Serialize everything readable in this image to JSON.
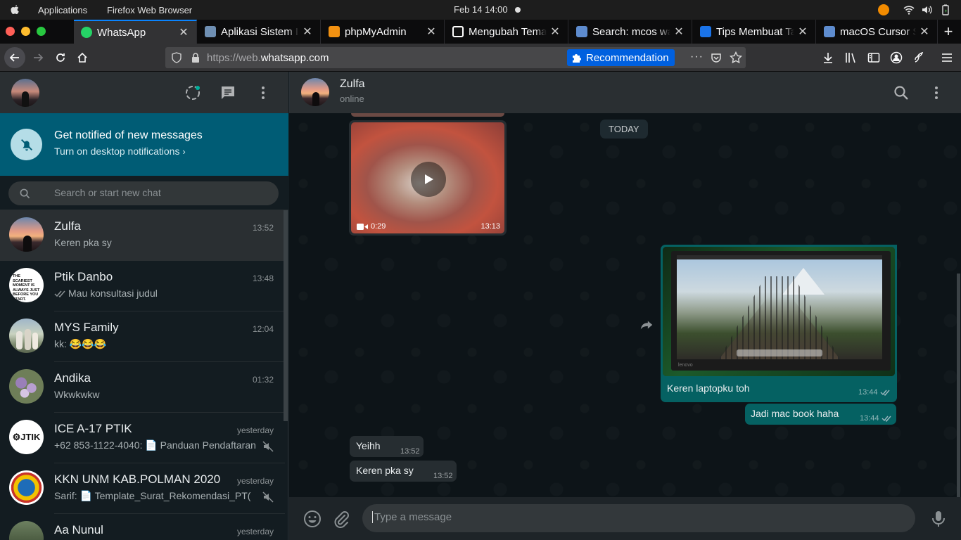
{
  "os": {
    "menu": [
      "Applications",
      "Firefox Web Browser"
    ],
    "clock": "Feb 14  14:00"
  },
  "browser": {
    "tabs": [
      {
        "title": "WhatsApp",
        "active": true,
        "favicon_color": "#25d366"
      },
      {
        "title": "Aplikasi Sistem Informasi",
        "active": false,
        "favicon_color": "#6f8fb3"
      },
      {
        "title": "phpMyAdmin",
        "active": false,
        "favicon_color": "#f29111"
      },
      {
        "title": "Mengubah Tema",
        "active": false,
        "favicon_color": "#ffffff"
      },
      {
        "title": "Search: mcos wallpaper",
        "active": false,
        "favicon_color": "#5e8ccf"
      },
      {
        "title": "Tips Membuat Tampilan",
        "active": false,
        "favicon_color": "#1a73e8"
      },
      {
        "title": "macOS Cursor Set",
        "active": false,
        "favicon_color": "#5e8ccf"
      }
    ],
    "url_dim": "https://web.",
    "url_host": "whatsapp.com",
    "recommendation_label": "Recommendation"
  },
  "sidebar": {
    "notification": {
      "title": "Get notified of new messages",
      "subtitle": "Turn on desktop notifications"
    },
    "search_placeholder": "Search or start new chat",
    "chats": [
      {
        "name": "Zulfa",
        "time": "13:52",
        "preview": "Keren pka sy",
        "selected": true,
        "read_ticks": false,
        "muted": false,
        "avatar": "sunset"
      },
      {
        "name": "Ptik Danbo",
        "time": "13:48",
        "preview": "Mau konsultasi judul",
        "selected": false,
        "read_ticks": true,
        "muted": false,
        "avatar": "text"
      },
      {
        "name": "MYS Family",
        "time": "12:04",
        "preview": "kk: 😂😂😂",
        "selected": false,
        "read_ticks": false,
        "muted": false,
        "avatar": "people"
      },
      {
        "name": "Andika",
        "time": "01:32",
        "preview": "Wkwkwkw",
        "selected": false,
        "read_ticks": false,
        "muted": false,
        "avatar": "flowers"
      },
      {
        "name": "ICE A-17 PTIK",
        "time": "yesterday",
        "preview": "+62 853-1122-4040: 📄 Panduan Pendaftaran",
        "selected": false,
        "read_ticks": false,
        "muted": true,
        "avatar": "jtik"
      },
      {
        "name": "KKN UNM KAB.POLMAN 2020",
        "time": "yesterday",
        "preview": "Sarif: 📄 Template_Surat_Rekomendasi_PT(",
        "selected": false,
        "read_ticks": false,
        "muted": true,
        "avatar": "emblem"
      },
      {
        "name": "Aa Nunul",
        "time": "yesterday",
        "preview": "",
        "selected": false,
        "read_ticks": false,
        "muted": false,
        "avatar": "tree"
      }
    ],
    "avatar_text_lines": [
      "THE SCARIEST",
      "MOMENT IS",
      "ALWAYS JUST",
      "BEFORE YOU",
      "START."
    ],
    "jtik_label": "JTIK"
  },
  "conversation": {
    "contact_name": "Zulfa",
    "contact_status": "online",
    "date_divider": "TODAY",
    "video": {
      "duration": "0:29",
      "time": "13:13"
    },
    "image_message": {
      "caption": "Keren laptopku toh",
      "time": "13:44",
      "brand": "lenovo"
    },
    "messages": [
      {
        "direction": "out",
        "text": "Jadi mac book haha",
        "time": "13:44"
      },
      {
        "direction": "in",
        "text": "Yeihh",
        "time": "13:52"
      },
      {
        "direction": "in",
        "text": "Keren pka sy",
        "time": "13:52"
      }
    ],
    "composer_placeholder": "Type a message"
  },
  "colors": {
    "accent": "#00af9c",
    "outgoing_bubble": "#056162",
    "incoming_bubble": "#262d31",
    "notification_banner": "#005c75",
    "read_tick": "#34b7f1"
  },
  "icons": [
    "apple-icon",
    "status-icon",
    "new-chat-icon",
    "menu-icon",
    "bell-off-icon",
    "search-icon",
    "mute-icon",
    "play-icon",
    "video-icon",
    "forward-icon",
    "emoji-icon",
    "attach-icon",
    "mic-icon"
  ]
}
